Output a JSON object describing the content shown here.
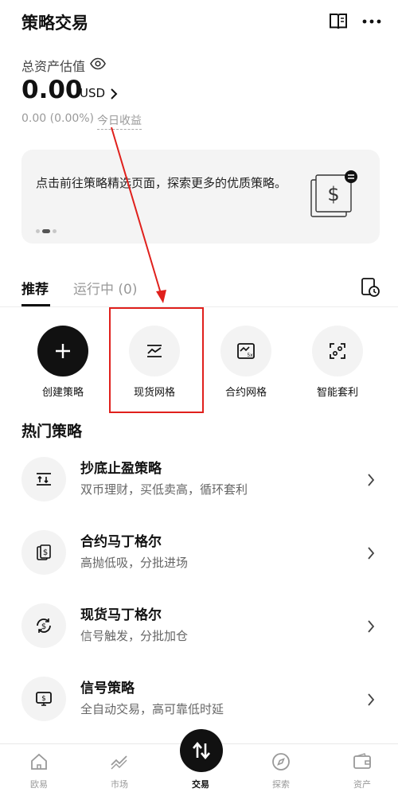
{
  "header": {
    "title": "策略交易"
  },
  "assets": {
    "label": "总资产估值",
    "amount": "0.00",
    "currency": "USD",
    "pnl": "0.00 (0.00%)",
    "today_label": "今日收益"
  },
  "banner": {
    "text": "点击前往策略精选页面，探索更多的优质策略。",
    "active_dot": 1
  },
  "tabs": [
    {
      "label": "推荐"
    },
    {
      "label": "运行中 (0)"
    }
  ],
  "quick_actions": [
    {
      "label": "创建策略",
      "icon": "plus-icon"
    },
    {
      "label": "现货网格",
      "icon": "grid-chart-icon"
    },
    {
      "label": "合约网格",
      "icon": "futures-grid-icon"
    },
    {
      "label": "智能套利",
      "icon": "arbitrage-icon"
    }
  ],
  "hot": {
    "title": "热门策略",
    "items": [
      {
        "name": "抄底止盈策略",
        "desc": "双币理财，买低卖高，循环套利",
        "icon": "buy-low-icon"
      },
      {
        "name": "合约马丁格尔",
        "desc": "高抛低吸，分批进场",
        "icon": "futures-martingale-icon"
      },
      {
        "name": "现货马丁格尔",
        "desc": "信号触发，分批加仓",
        "icon": "spot-martingale-icon"
      },
      {
        "name": "信号策略",
        "desc": "全自动交易，高可靠低时延",
        "icon": "signal-icon"
      }
    ]
  },
  "nav": [
    {
      "label": "欧易",
      "icon": "home-icon"
    },
    {
      "label": "市场",
      "icon": "market-icon"
    },
    {
      "label": "交易",
      "icon": "trade-icon"
    },
    {
      "label": "探索",
      "icon": "compass-icon"
    },
    {
      "label": "资产",
      "icon": "wallet-icon"
    }
  ],
  "colors": {
    "accent": "#111111",
    "annotation": "#e0201c",
    "muted": "#9a9a9a"
  }
}
